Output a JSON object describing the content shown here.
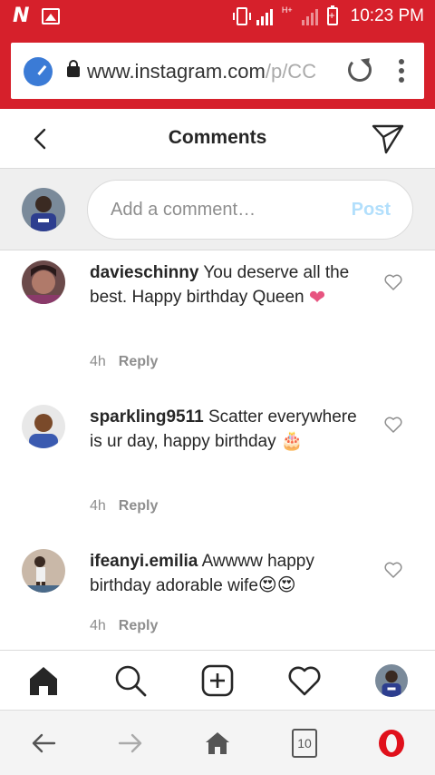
{
  "status_bar": {
    "time": "10:23 PM",
    "network": "H+"
  },
  "browser": {
    "url_main": "www.instagram.com",
    "url_faded": "/p/CC",
    "tabs_count": "10"
  },
  "header": {
    "title": "Comments"
  },
  "composer": {
    "placeholder": "Add a comment…",
    "post_label": "Post"
  },
  "comments": [
    {
      "username": "davieschinny",
      "text": "You deserve all the best. Happy birthday Queen",
      "emoji": "❤",
      "time": "4h",
      "reply": "Reply"
    },
    {
      "username": "sparkling9511",
      "text": "Scatter everywhere is ur day, happy birthday",
      "emoji": "🎂",
      "time": "4h",
      "reply": "Reply"
    },
    {
      "username": "ifeanyi.emilia",
      "text": "Awwww happy birthday adorable wife",
      "emoji": "😍😍",
      "time": "4h",
      "reply": "Reply"
    }
  ],
  "colors": {
    "statusbar": "#d6202b",
    "post_disabled": "#b2dffc",
    "heart": "#e75480",
    "opera_red": "#e0101b"
  },
  "icons": [
    "back-icon",
    "send-icon",
    "home-icon",
    "search-icon",
    "new-post-icon",
    "activity-icon",
    "profile-avatar",
    "browser-back-icon",
    "browser-forward-icon",
    "browser-home-icon",
    "tabs-icon",
    "opera-icon"
  ]
}
